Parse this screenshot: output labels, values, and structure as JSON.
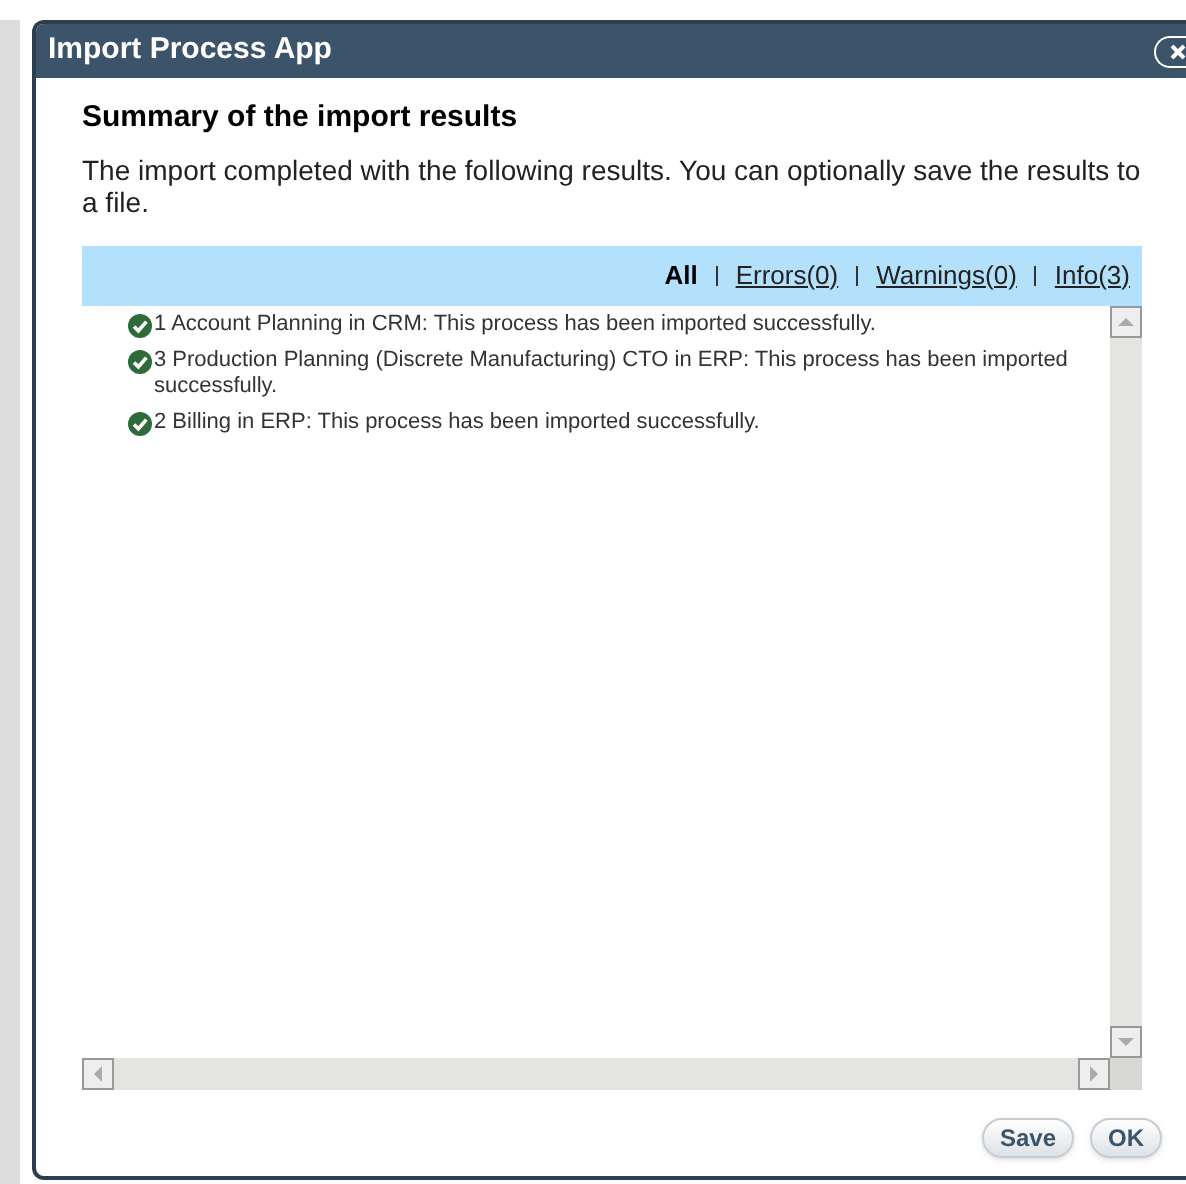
{
  "dialog": {
    "title": "Import Process App",
    "heading": "Summary of the import results",
    "description": "The import completed with the following results. You can optionally save the results to a file."
  },
  "filters": [
    {
      "label": "All",
      "selected": true
    },
    {
      "label": "Errors(0)",
      "selected": false
    },
    {
      "label": "Warnings(0)",
      "selected": false
    },
    {
      "label": "Info(3)",
      "selected": false
    }
  ],
  "results": [
    {
      "kind": "success",
      "text": "1 Account Planning in CRM: This process has been imported successfully."
    },
    {
      "kind": "success",
      "text": "3 Production Planning (Discrete Manufacturing) CTO in ERP: This process has been imported successfully."
    },
    {
      "kind": "success",
      "text": "2 Billing in ERP: This process has been imported successfully."
    }
  ],
  "buttons": [
    "Save",
    "OK"
  ]
}
